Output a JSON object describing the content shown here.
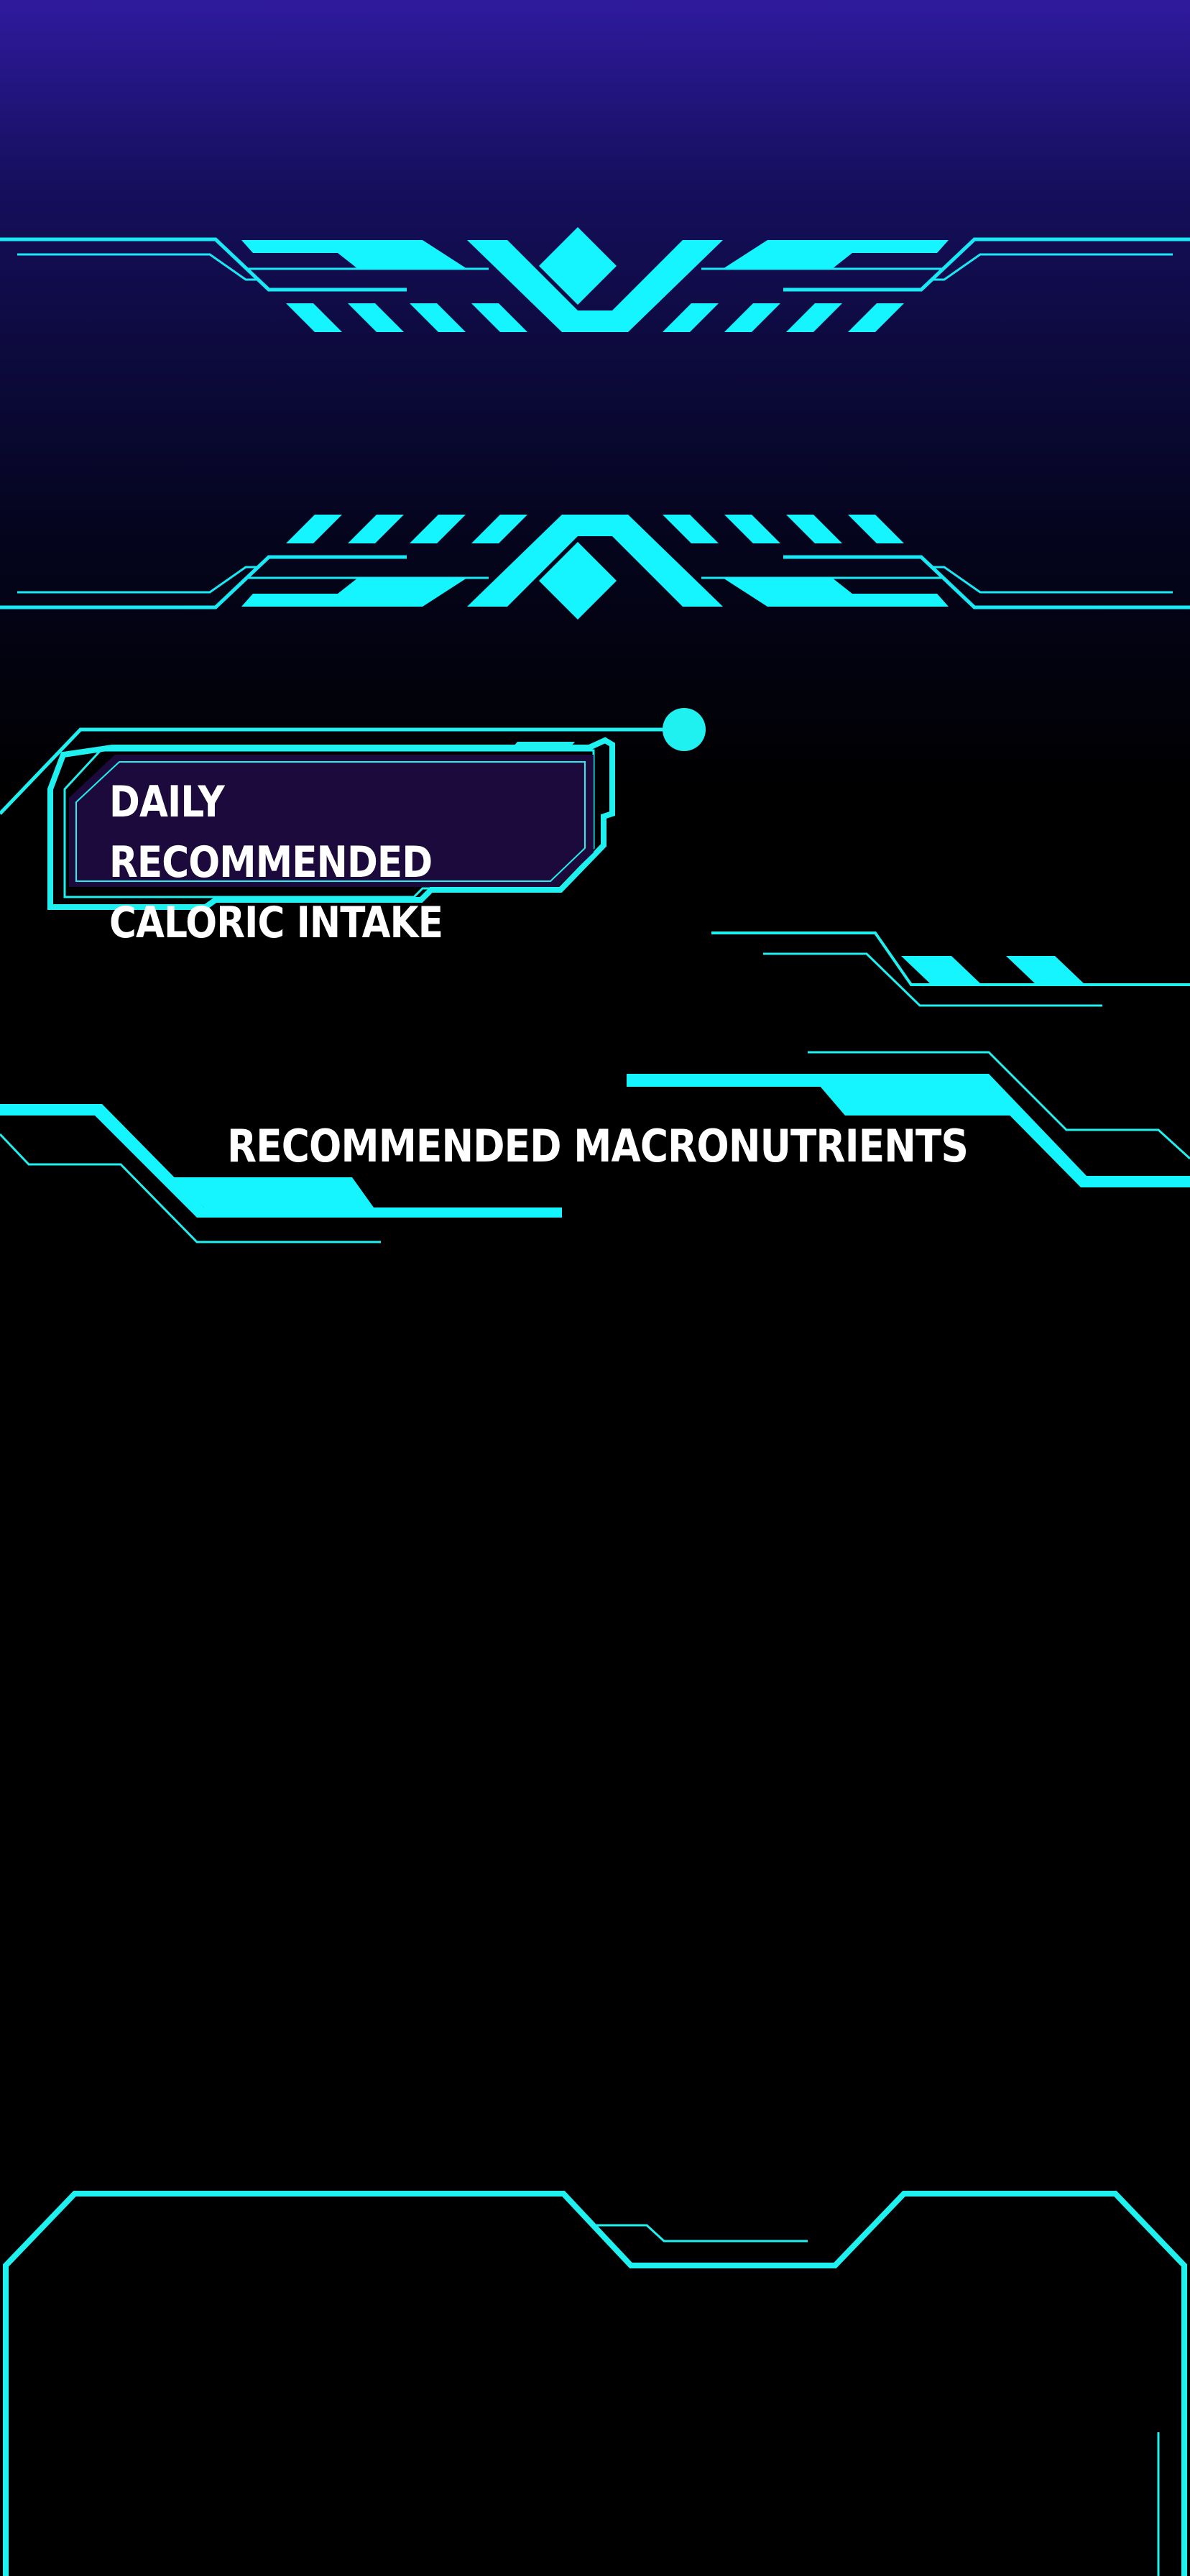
{
  "sections": {
    "caloric_title": "DAILY RECOMMENDED CALORIC INTAKE",
    "macro_title": "RECOMMENDED MACRONUTRIENTS"
  },
  "theme": {
    "accent": "#1ff0f0",
    "accent_bright": "#14f5ff",
    "label_fill": "#1c0a3d",
    "bg_top": "#2f1a9e",
    "bg_bottom": "#000000",
    "text": "#ffffff"
  }
}
